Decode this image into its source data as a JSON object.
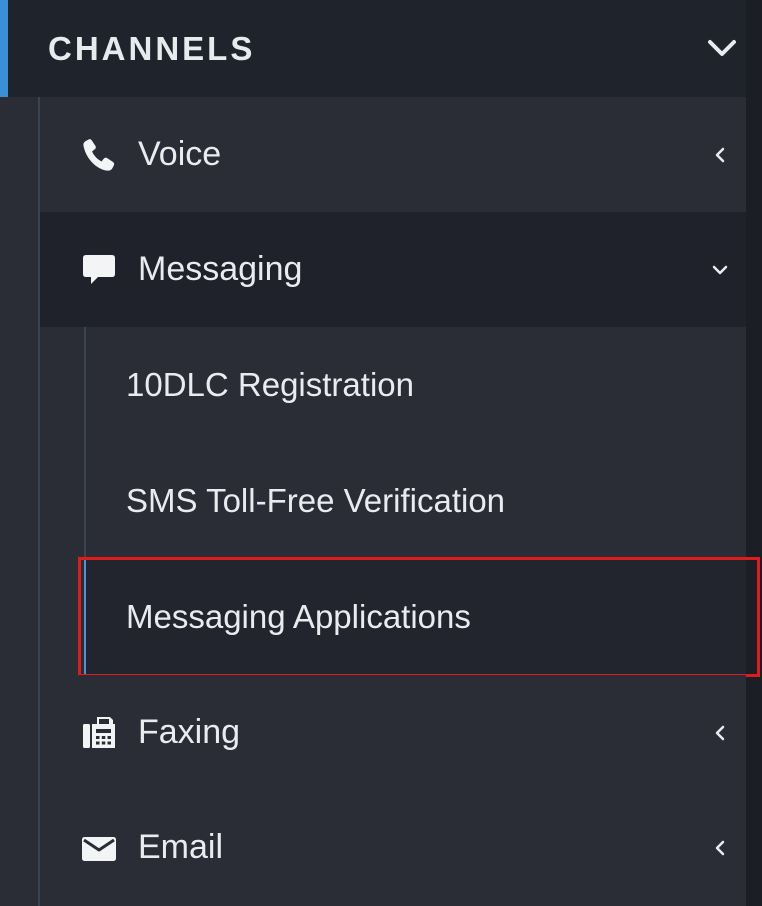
{
  "section": {
    "title": "CHANNELS"
  },
  "nav": {
    "voice": {
      "label": "Voice",
      "icon": "phone-icon"
    },
    "messaging": {
      "label": "Messaging",
      "icon": "chat-bubble-icon"
    },
    "faxing": {
      "label": "Faxing",
      "icon": "fax-icon"
    },
    "email": {
      "label": "Email",
      "icon": "envelope-icon"
    }
  },
  "messaging_submenu": [
    {
      "label": "10DLC Registration"
    },
    {
      "label": "SMS Toll-Free Verification"
    },
    {
      "label": "Messaging Applications",
      "active": true
    }
  ],
  "colors": {
    "accent": "#3a8fd6",
    "highlight": "#e01b1b",
    "background": "#2a2d36",
    "header_background": "#1f232b"
  }
}
